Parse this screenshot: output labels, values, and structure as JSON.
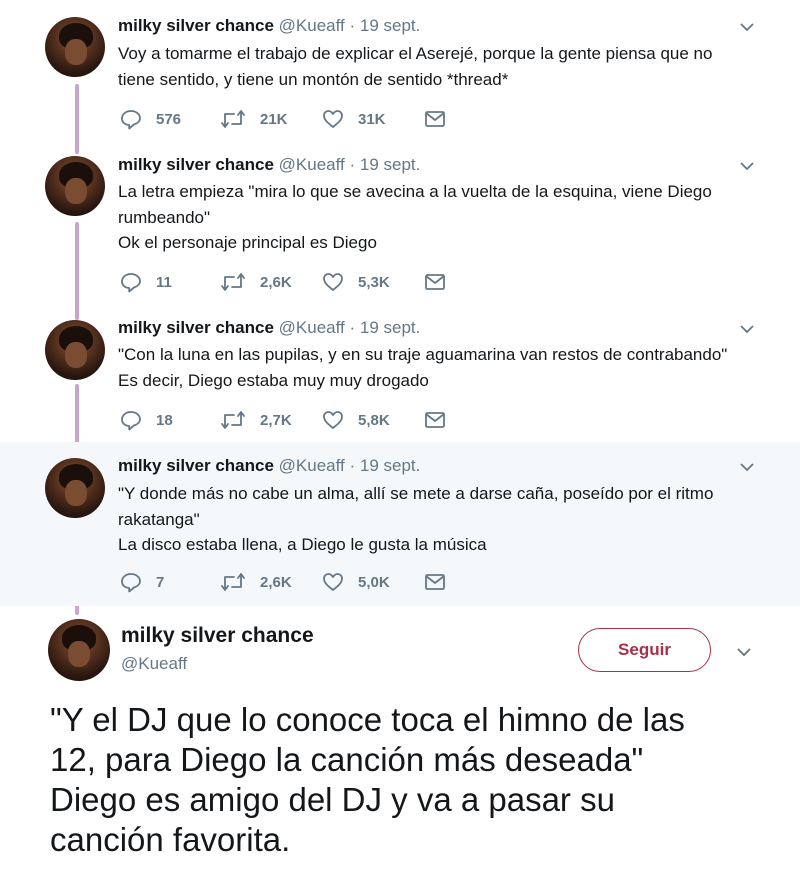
{
  "colors": {
    "thread_line": "#c9a4cc",
    "follow_accent": "#a6324a",
    "muted": "#657786",
    "highlight_bg": "#f5f8fa"
  },
  "tweets": [
    {
      "name": "milky silver chance",
      "meta": "@Kueaff · 19 sept.",
      "lines": [
        "Voy a tomarme el trabajo de explicar el Aserejé, porque la gente piensa que no",
        "tiene sentido, y tiene un montón de sentido *thread*"
      ],
      "replies": "576",
      "retweets": "21K",
      "likes": "31K"
    },
    {
      "name": "milky silver chance",
      "meta": "@Kueaff · 19 sept.",
      "lines": [
        "La letra empieza \"mira lo que se avecina a la vuelta de la esquina, viene Diego",
        "rumbeando\"",
        "Ok el personaje principal es Diego"
      ],
      "replies": "11",
      "retweets": "2,6K",
      "likes": "5,3K"
    },
    {
      "name": "milky silver chance",
      "meta": "@Kueaff · 19 sept.",
      "lines": [
        "\"Con la luna en las pupilas, y en su traje aguamarina van restos de contrabando\"",
        "Es decir, Diego estaba muy muy drogado"
      ],
      "replies": "18",
      "retweets": "2,7K",
      "likes": "5,8K"
    },
    {
      "name": "milky silver chance",
      "meta": "@Kueaff · 19 sept.",
      "lines": [
        "\"Y donde más no cabe un alma, allí se mete a darse caña, poseído por el ritmo",
        "rakatanga\"",
        "La disco estaba llena, a Diego le gusta la música"
      ],
      "replies": "7",
      "retweets": "2,6K",
      "likes": "5,0K"
    }
  ],
  "main_tweet": {
    "name": "milky silver chance",
    "handle": "@Kueaff",
    "follow_label": "Seguir",
    "lines": [
      "\"Y el DJ que lo conoce toca el himno de las",
      "12, para Diego la canción más deseada\"",
      "Diego es amigo del DJ y va a pasar su",
      "canción favorita."
    ]
  }
}
